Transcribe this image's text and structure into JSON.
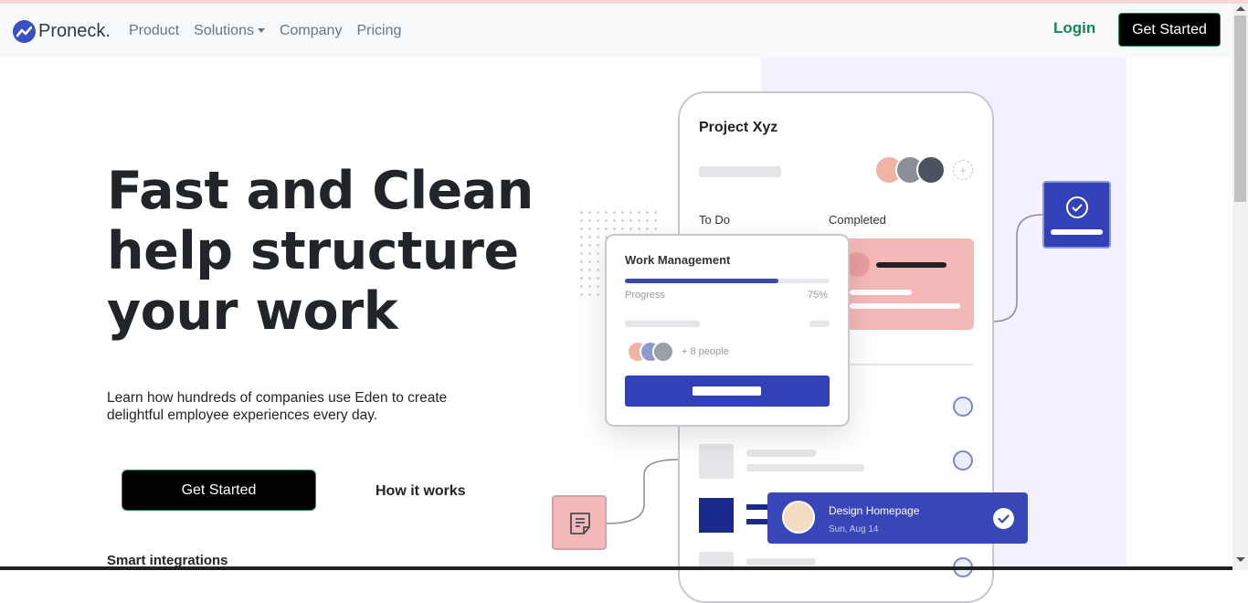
{
  "nav": {
    "brand": "Proneck.",
    "links": [
      "Product",
      "Solutions",
      "Company",
      "Pricing"
    ],
    "login": "Login",
    "cta": "Get Started"
  },
  "hero": {
    "title_lines": [
      "Fast and Clean",
      "help structure",
      "your work"
    ],
    "subtitle": "Learn how hundreds of companies use Eden to create delightful employee experiences every day.",
    "primary_cta": "Get Started",
    "secondary_cta": "How it works",
    "next_section": "Smart integrations"
  },
  "illustration": {
    "project_title": "Project Xyz",
    "columns": [
      "To Do",
      "Completed"
    ],
    "work_card": {
      "title": "Work Management",
      "progress_label": "Progress",
      "progress_text": "75%",
      "progress_fraction": 0.75,
      "people": "+ 8 people"
    },
    "task": {
      "name": "Design Homepage",
      "date": "Sun, Aug 14"
    },
    "colors": {
      "accent_blue": "#3341b8",
      "accent_pink": "#f4b8b8",
      "cta_green_border": "#198754"
    }
  }
}
